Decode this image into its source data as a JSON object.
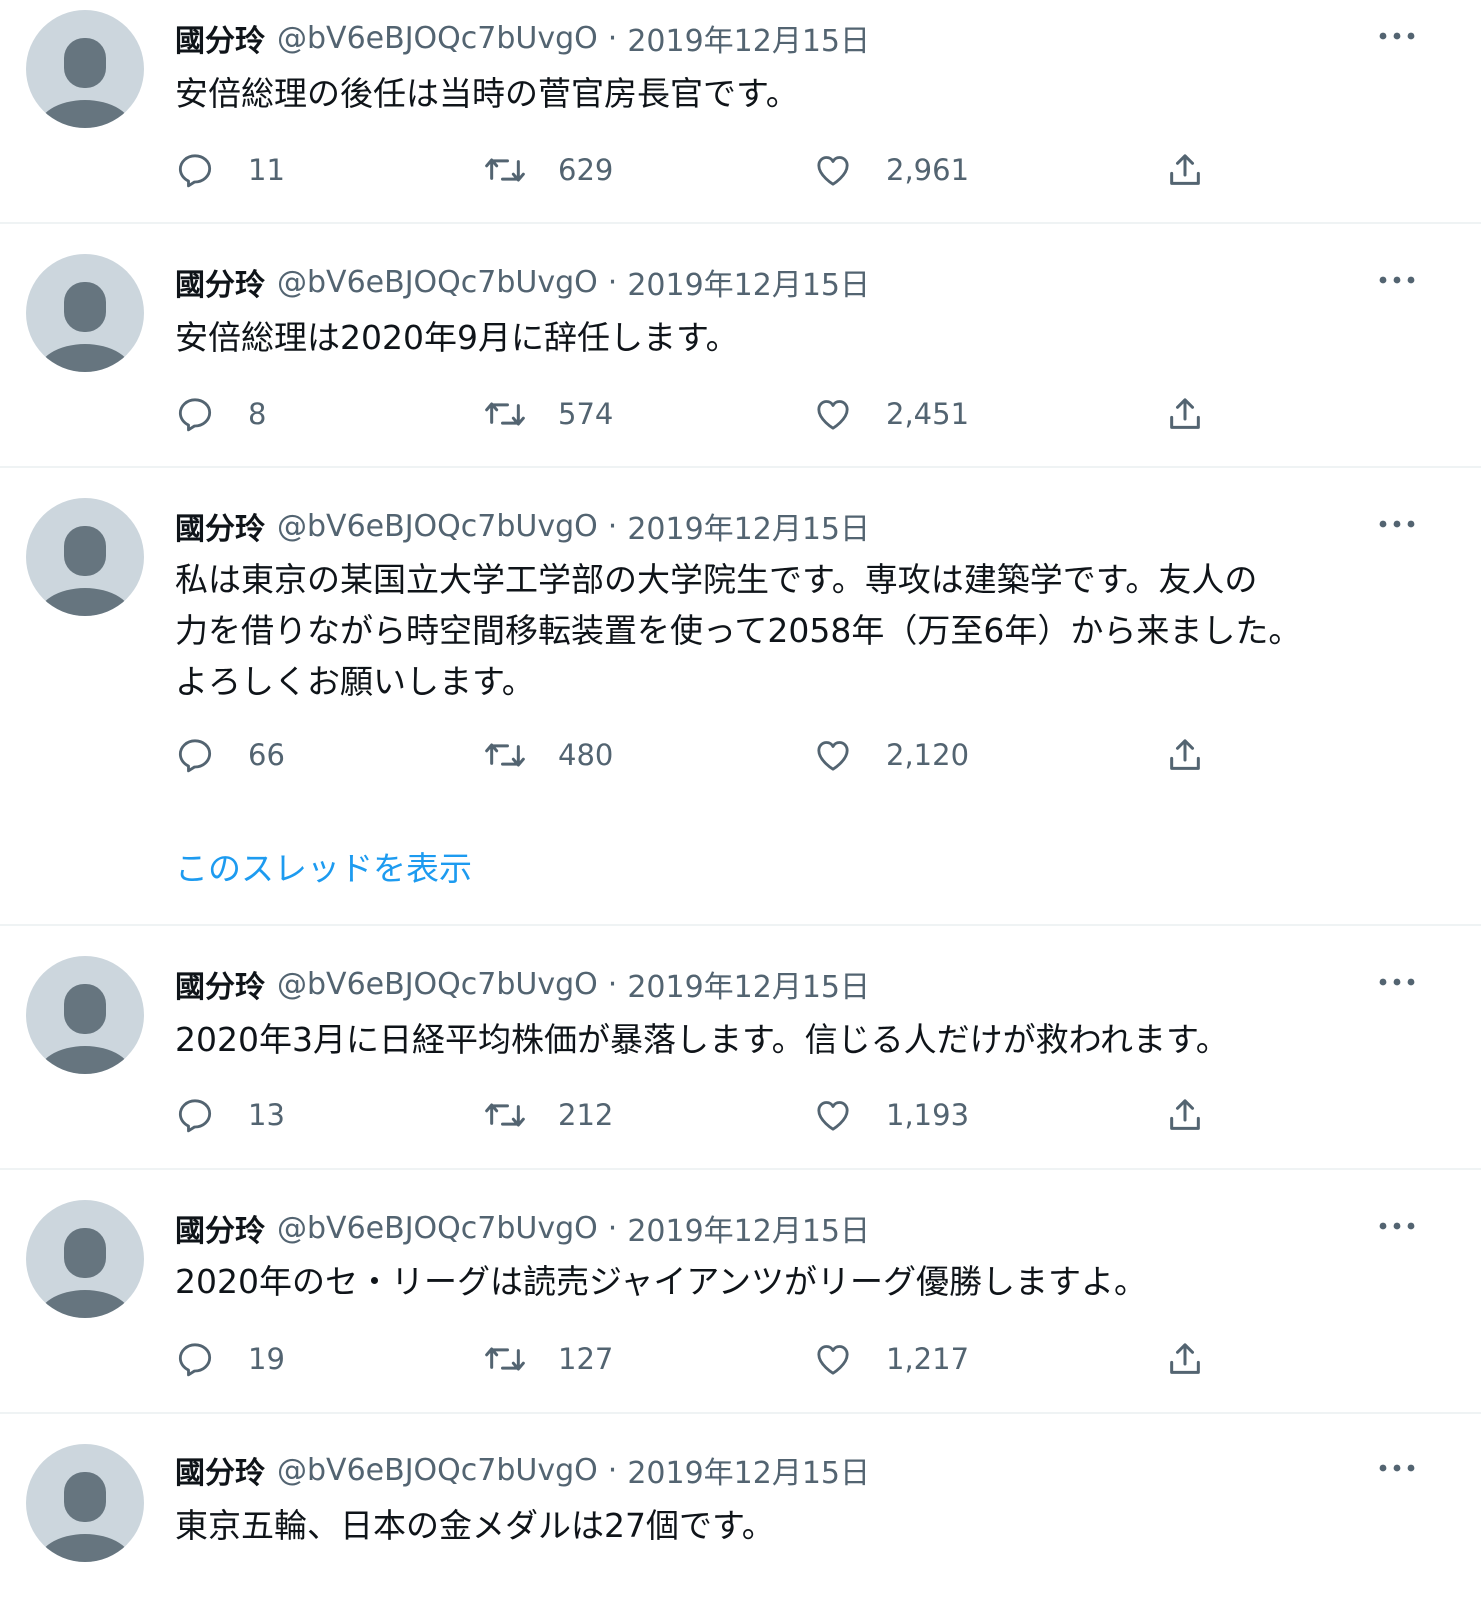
{
  "tweets": [
    {
      "name": "國分玲",
      "handle": "@bV6eBJOQc7bUvgO",
      "date": "2019年12月15日",
      "text": "安倍総理の後任は当時の菅官房長官です。",
      "replies": "11",
      "retweets": "629",
      "likes": "2,961"
    },
    {
      "name": "國分玲",
      "handle": "@bV6eBJOQc7bUvgO",
      "date": "2019年12月15日",
      "text": "安倍総理は2020年9月に辞任します。",
      "replies": "8",
      "retweets": "574",
      "likes": "2,451"
    },
    {
      "name": "國分玲",
      "handle": "@bV6eBJOQc7bUvgO",
      "date": "2019年12月15日",
      "text_lines": [
        "私は東京の某国立大学工学部の大学院生です。専攻は建築学です。友人の",
        "力を借りながら時空間移転装置を使って2058年（万至6年）から来ました。",
        "よろしくお願いします。"
      ],
      "replies": "66",
      "retweets": "480",
      "likes": "2,120",
      "thread_link": "このスレッドを表示"
    },
    {
      "name": "國分玲",
      "handle": "@bV6eBJOQc7bUvgO",
      "date": "2019年12月15日",
      "text": "2020年3月に日経平均株価が暴落します。信じる人だけが救われます。",
      "replies": "13",
      "retweets": "212",
      "likes": "1,193"
    },
    {
      "name": "國分玲",
      "handle": "@bV6eBJOQc7bUvgO",
      "date": "2019年12月15日",
      "text": "2020年のセ・リーグは読売ジャイアンツがリーグ優勝しますよ。",
      "replies": "19",
      "retweets": "127",
      "likes": "1,217"
    },
    {
      "name": "國分玲",
      "handle": "@bV6eBJOQc7bUvgO",
      "date": "2019年12月15日",
      "text": "東京五輪、日本の金メダルは27個です。"
    }
  ],
  "separator": "·",
  "icons": {
    "reply": "reply-icon",
    "retweet": "retweet-icon",
    "like": "heart-icon",
    "share": "share-icon",
    "more": "more-icon",
    "avatar": "default-avatar"
  },
  "colors": {
    "text": "#0f1419",
    "secondary": "#536471",
    "link": "#1d9bf0",
    "avatar_bg": "#ccd6dd",
    "avatar_fg": "#66757f",
    "divider": "#eff3f4"
  }
}
